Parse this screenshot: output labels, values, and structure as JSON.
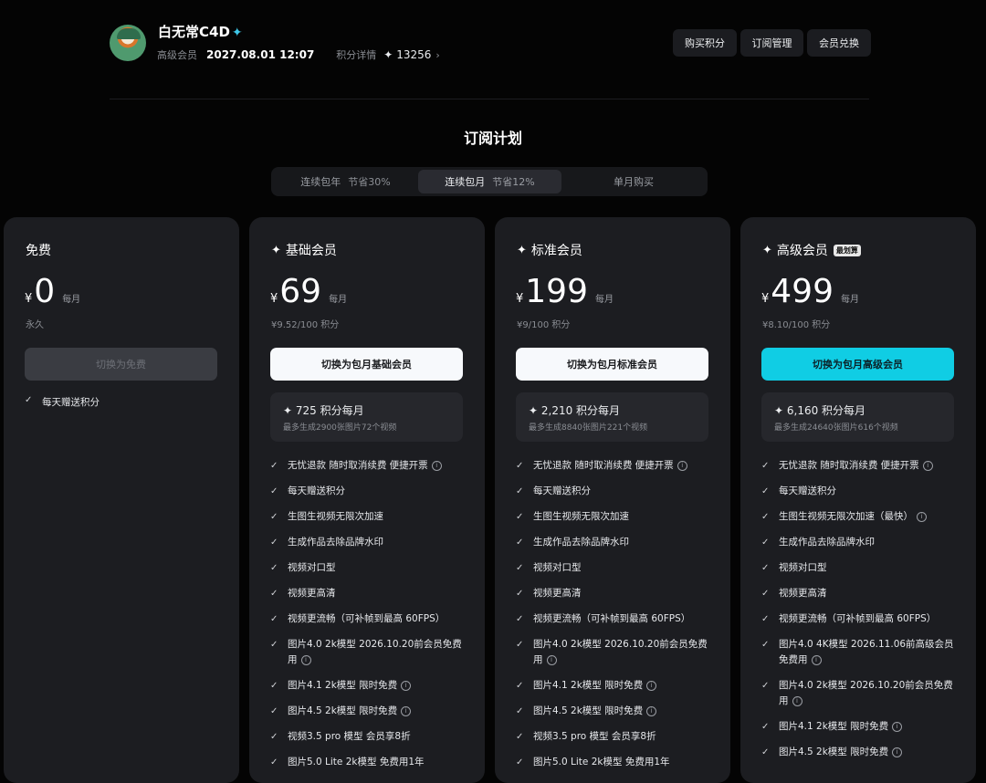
{
  "header": {
    "username": "白无常C4D",
    "membership_level": "高级会员",
    "expire_time": "2027.08.01 12:07",
    "points_label": "积分详情",
    "points_icon": "✦",
    "points_value": "13256",
    "buttons": {
      "buy_points": "购买积分",
      "subscription_manage": "订阅管理",
      "member_redeem": "会员兑换"
    }
  },
  "section_title": "订阅计划",
  "tabs": [
    {
      "label": "连续包年",
      "save": "节省30%",
      "active": false
    },
    {
      "label": "连续包月",
      "save": "节省12%",
      "active": true
    },
    {
      "label": "单月购买",
      "save": "",
      "active": false
    }
  ],
  "plans": [
    {
      "name": "免费",
      "currency": "¥",
      "price": "0",
      "period": "每月",
      "note": "永久",
      "cta": "切换为免费",
      "features": [
        "每天赠送积分"
      ]
    },
    {
      "name": "基础会员",
      "icon": "✦",
      "currency": "¥",
      "price": "69",
      "period": "每月",
      "per_points": "¥9.52/100 积分",
      "cta": "切换为包月基础会员",
      "quota_title": "725 积分每月",
      "quota_sub": "最多生成2900张图片72个视频",
      "features": [
        "无忧退款 随时取消续费 便捷开票",
        "每天赠送积分",
        "生图生视频无限次加速",
        "生成作品去除品牌水印",
        "视频对口型",
        "视频更高清",
        "视频更流畅（可补帧到最高 60FPS）",
        "图片4.0 2k模型 2026.10.20前会员免费用",
        "图片4.1 2k模型 限时免费",
        "图片4.5 2k模型 限时免费",
        "视频3.5 pro 模型 会员享8折",
        "图片5.0 Lite 2k模型 免费用1年"
      ]
    },
    {
      "name": "标准会员",
      "icon": "✦",
      "currency": "¥",
      "price": "199",
      "period": "每月",
      "per_points": "¥9/100 积分",
      "cta": "切换为包月标准会员",
      "quota_title": "2,210 积分每月",
      "quota_sub": "最多生成8840张图片221个视频",
      "features": [
        "无忧退款 随时取消续费 便捷开票",
        "每天赠送积分",
        "生图生视频无限次加速",
        "生成作品去除品牌水印",
        "视频对口型",
        "视频更高清",
        "视频更流畅（可补帧到最高 60FPS）",
        "图片4.0 2k模型 2026.10.20前会员免费用",
        "图片4.1 2k模型 限时免费",
        "图片4.5 2k模型 限时免费",
        "视频3.5 pro 模型 会员享8折",
        "图片5.0 Lite 2k模型 免费用1年"
      ]
    },
    {
      "name": "高级会员",
      "icon": "✦",
      "badge": "最划算",
      "currency": "¥",
      "price": "499",
      "period": "每月",
      "per_points": "¥8.10/100 积分",
      "cta": "切换为包月高级会员",
      "quota_title": "6,160 积分每月",
      "quota_sub": "最多生成24640张图片616个视频",
      "features": [
        "无忧退款 随时取消续费 便捷开票",
        "每天赠送积分",
        "生图生视频无限次加速（最快）",
        "生成作品去除品牌水印",
        "视频对口型",
        "视频更高清",
        "视频更流畅（可补帧到最高 60FPS）",
        "图片4.0 4K模型 2026.11.06前高级会员免费用",
        "图片4.0 2k模型 2026.10.20前会员免费用",
        "图片4.1 2k模型 限时免费",
        "图片4.5 2k模型 限时免费"
      ]
    }
  ]
}
